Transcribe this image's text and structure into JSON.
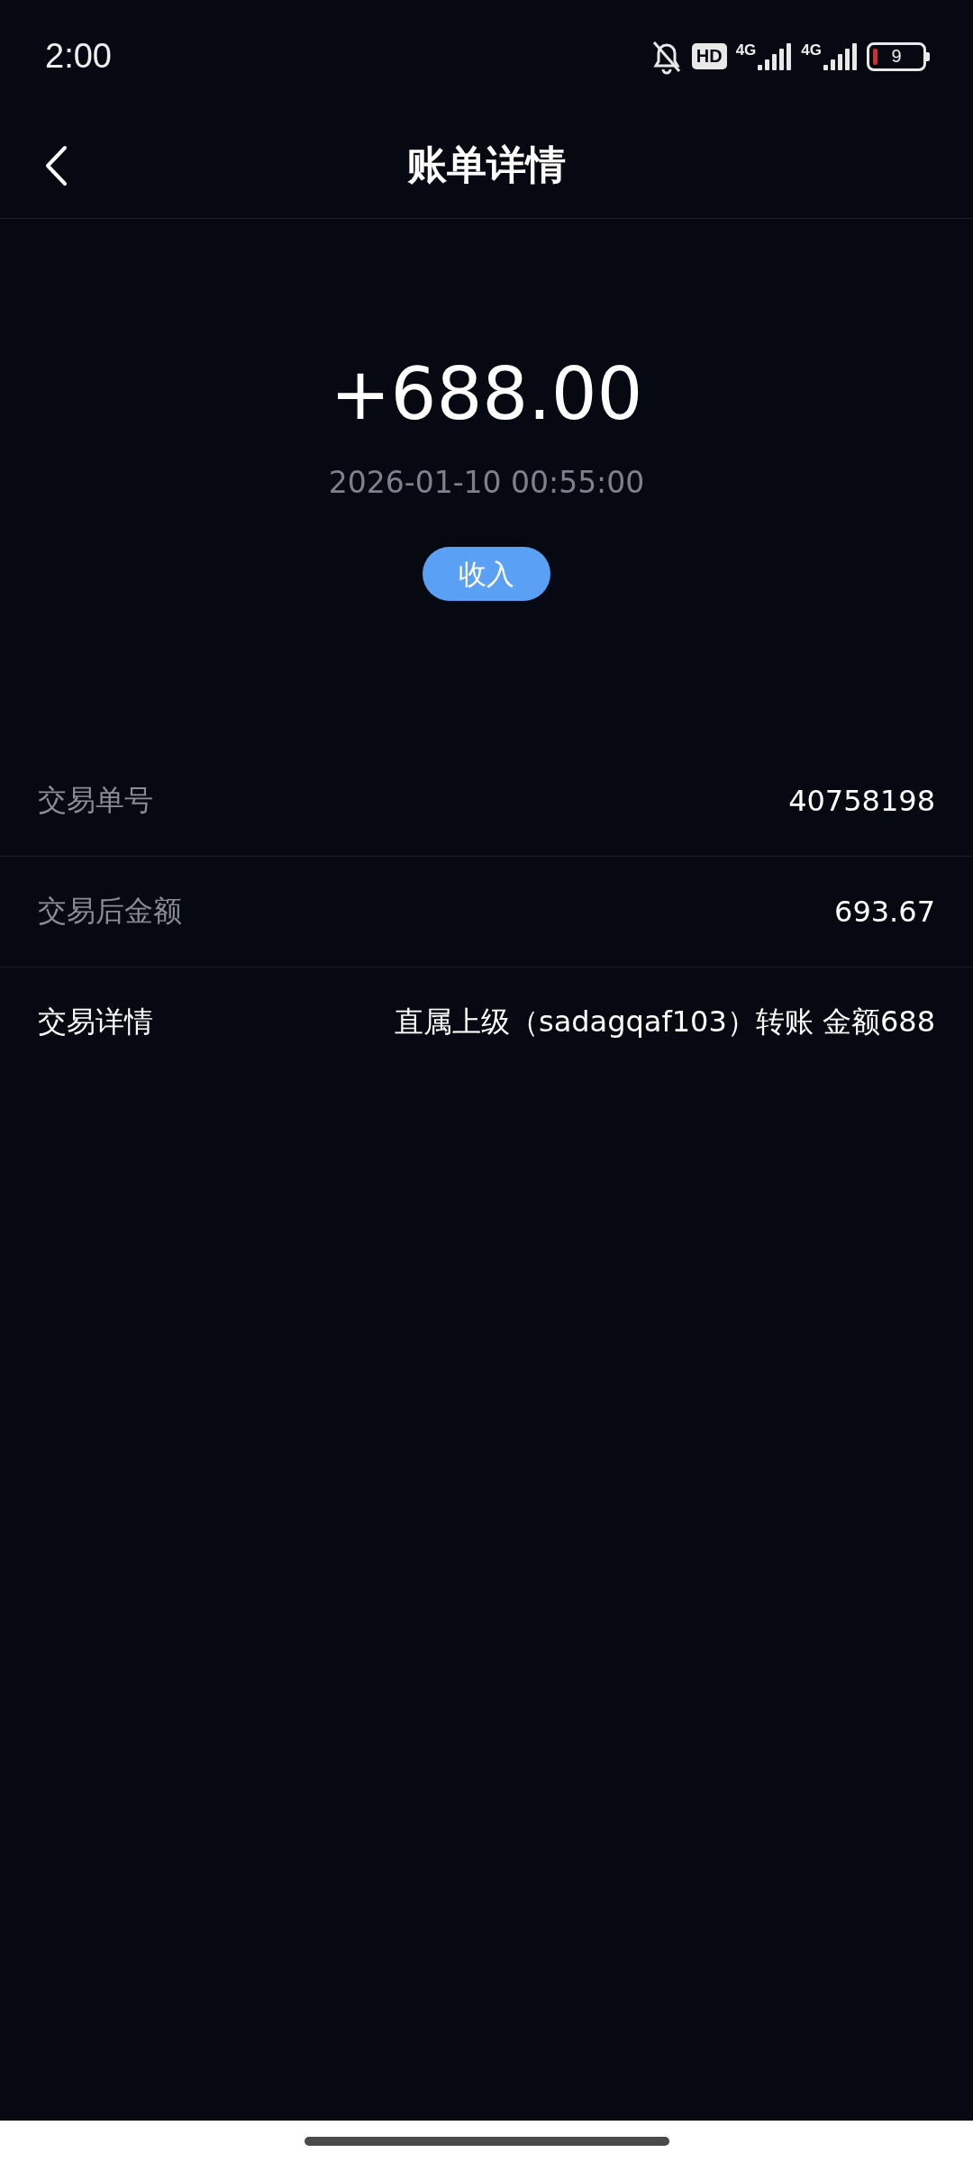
{
  "status_bar": {
    "time": "2:00",
    "hd_badge": "HD",
    "networks": [
      "4G",
      "4G"
    ],
    "battery": "9"
  },
  "header": {
    "title": "账单详情"
  },
  "summary": {
    "amount": "+688.00",
    "datetime": "2026-01-10 00:55:00",
    "type_tag": "收入"
  },
  "details": [
    {
      "label": "交易单号",
      "value": "40758198",
      "emphasized": false
    },
    {
      "label": "交易后金额",
      "value": "693.67",
      "emphasized": false
    },
    {
      "label": "交易详情",
      "value": "直属上级（sadagqaf103）转账 金额688",
      "emphasized": true
    }
  ]
}
